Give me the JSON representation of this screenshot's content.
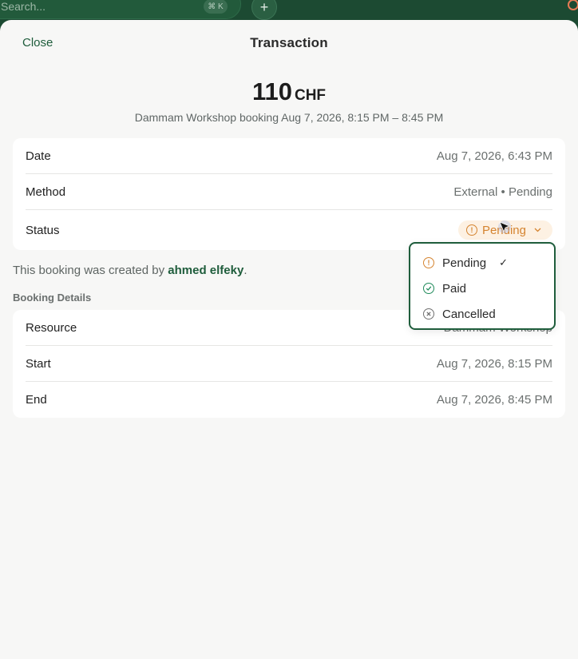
{
  "topbar": {
    "search_placeholder": "Search...",
    "shortcut": "⌘ K",
    "add_label": "+"
  },
  "sheet": {
    "close_label": "Close",
    "title": "Transaction"
  },
  "amount": {
    "value": "110",
    "currency": "CHF",
    "summary": "Dammam Workshop booking Aug 7, 2026, 8:15 PM – 8:45 PM"
  },
  "details": {
    "date_label": "Date",
    "date_value": "Aug 7, 2026, 6:43 PM",
    "method_label": "Method",
    "method_value": "External • Pending",
    "status_label": "Status",
    "status_value": "Pending"
  },
  "created_by": {
    "prefix": "This booking was created by ",
    "user": "ahmed elfeky",
    "suffix": "."
  },
  "booking_details": {
    "section_title": "Booking Details",
    "resource_label": "Resource",
    "resource_value": "Dammam Workshop",
    "start_label": "Start",
    "start_value": "Aug 7, 2026, 8:15 PM",
    "end_label": "End",
    "end_value": "Aug 7, 2026, 8:45 PM"
  },
  "status_menu": {
    "options": [
      {
        "label": "Pending",
        "icon": "exclamation-circle-icon",
        "selected": true
      },
      {
        "label": "Paid",
        "icon": "check-circle-icon",
        "selected": false
      },
      {
        "label": "Cancelled",
        "icon": "x-circle-icon",
        "selected": false
      }
    ],
    "check_mark": "✓"
  },
  "colors": {
    "brand_green": "#1f5d3c",
    "pending_orange": "#d58430",
    "paid_green": "#1f8a5a"
  }
}
